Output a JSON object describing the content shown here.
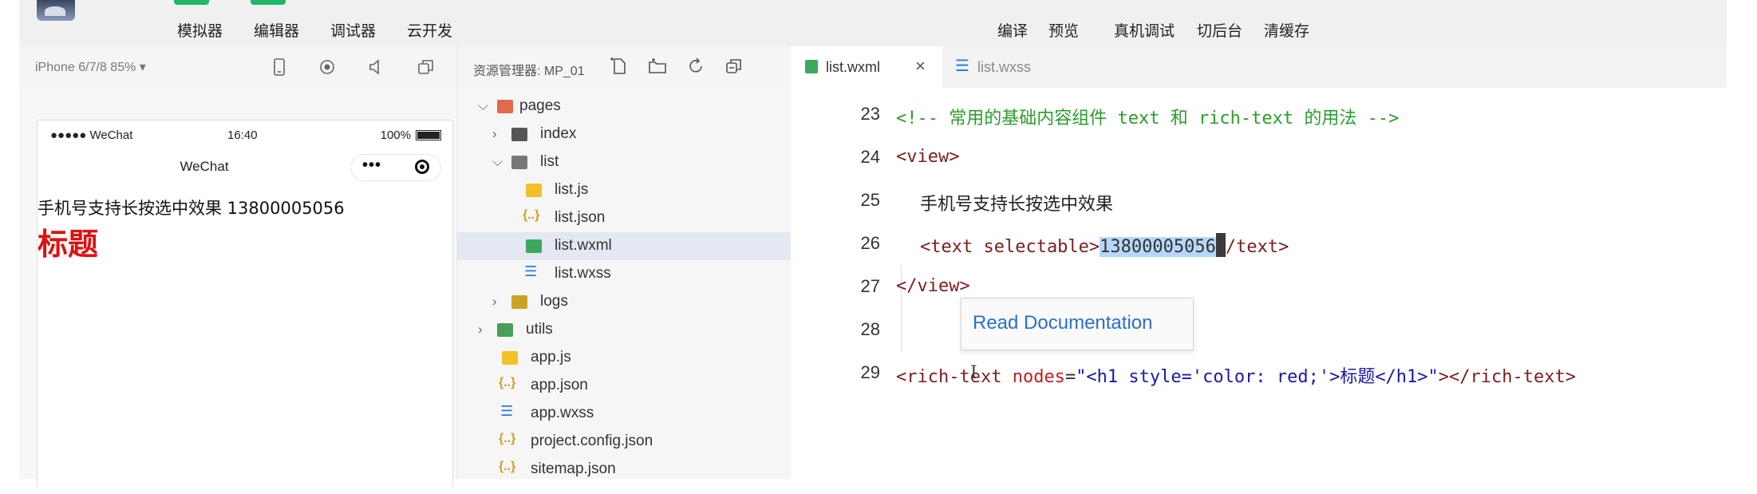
{
  "toolbar": {
    "left": [
      "模拟器",
      "编辑器",
      "调试器",
      "云开发"
    ],
    "right": [
      "编译",
      "预览",
      "真机调试",
      "切后台",
      "清缓存"
    ]
  },
  "simulator": {
    "device": "iPhone 6/7/8 85% ▾",
    "status": {
      "signal": "●●●●● WeChat",
      "time": "16:40",
      "battery": "100%"
    },
    "nav_title": "WeChat",
    "content_text": "手机号支持长按选中效果 13800005056",
    "content_heading": "标题"
  },
  "explorer": {
    "title": "资源管理器: MP_01",
    "tree": [
      {
        "label": "pages",
        "icon": "folder-open-icon",
        "chevron": "v"
      },
      {
        "label": "index",
        "icon": "folder-icon",
        "chevron": ">"
      },
      {
        "label": "list",
        "icon": "folder-open-icon",
        "chevron": "v"
      },
      {
        "label": "list.js",
        "icon": "js-file-icon"
      },
      {
        "label": "list.json",
        "icon": "json-file-icon"
      },
      {
        "label": "list.wxml",
        "icon": "wxml-file-icon",
        "selected": true
      },
      {
        "label": "list.wxss",
        "icon": "wxss-file-icon"
      },
      {
        "label": "logs",
        "icon": "folder-icon",
        "chevron": ">"
      },
      {
        "label": "utils",
        "icon": "folder-icon",
        "chevron": ">"
      },
      {
        "label": "app.js",
        "icon": "js-file-icon"
      },
      {
        "label": "app.json",
        "icon": "json-file-icon"
      },
      {
        "label": "app.wxss",
        "icon": "wxss-file-icon"
      },
      {
        "label": "project.config.json",
        "icon": "json-file-icon"
      },
      {
        "label": "sitemap.json",
        "icon": "json-file-icon"
      }
    ]
  },
  "editor": {
    "tabs": [
      {
        "label": "list.wxml",
        "active": true,
        "close": "×"
      },
      {
        "label": "list.wxss",
        "active": false
      }
    ],
    "lines": [
      {
        "num": "23",
        "text": "<!-- 常用的基础内容组件 text 和 rich-text 的用法 -->"
      },
      {
        "num": "24",
        "text": "<view>"
      },
      {
        "num": "25",
        "text": "手机号支持长按选中效果"
      },
      {
        "num": "26",
        "text": "<text selectable>13800005056</text>"
      },
      {
        "num": "27",
        "text": "</view>"
      },
      {
        "num": "28",
        "text": ""
      },
      {
        "num": "29",
        "text": "<rich-text nodes=\"<h1 style='color: red;'>标题</h1>\"></rich-text>"
      }
    ],
    "tooltip": "Read Documentation"
  },
  "colors": {
    "accent_green": "#1fb76a",
    "comment": "#2c9c2c",
    "tag": "#7a2020",
    "heading_red": "#e01010",
    "link_blue": "#2c6fc8"
  }
}
